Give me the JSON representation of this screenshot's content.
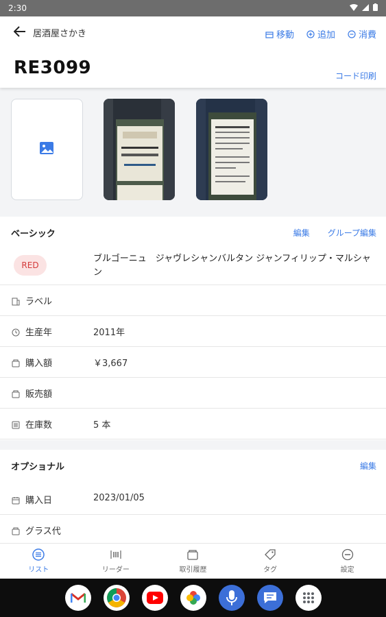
{
  "status_bar": {
    "time": "2:30"
  },
  "header": {
    "back_label": "居酒屋さかき",
    "actions": {
      "move": "移動",
      "add": "追加",
      "consume": "消費"
    },
    "item_code": "RE3099",
    "print_code": "コード印刷"
  },
  "basic": {
    "title": "ベーシック",
    "edit": "編集",
    "group_edit": "グループ編集",
    "badge": "RED",
    "wine_name": "ブルゴーニュ　ジャヴレシャンバルタン ジャンフィリップ・マルシャン",
    "rows": [
      {
        "icon": "label-icon",
        "label": "ラベル",
        "value": ""
      },
      {
        "icon": "clock-icon",
        "label": "生産年",
        "value": "2011年"
      },
      {
        "icon": "wallet-icon",
        "label": "購入額",
        "value": "￥3,667"
      },
      {
        "icon": "wallet-icon",
        "label": "販売額",
        "value": ""
      },
      {
        "icon": "inventory-icon",
        "label": "在庫数",
        "value": "5 本"
      }
    ]
  },
  "optional": {
    "title": "オプショナル",
    "edit": "編集",
    "rows": [
      {
        "icon": "calendar-icon",
        "label": "購入日",
        "value": "2023/01/05"
      },
      {
        "icon": "wallet-icon",
        "label": "グラス代",
        "value": ""
      }
    ]
  },
  "bottom_nav": {
    "list": "リスト",
    "reader": "リーダー",
    "history": "取引履歴",
    "tag": "タグ",
    "settings": "設定"
  },
  "colors": {
    "accent": "#3b7be6",
    "red_badge_bg": "#fbe3e3",
    "red_badge_text": "#d33a3a"
  }
}
